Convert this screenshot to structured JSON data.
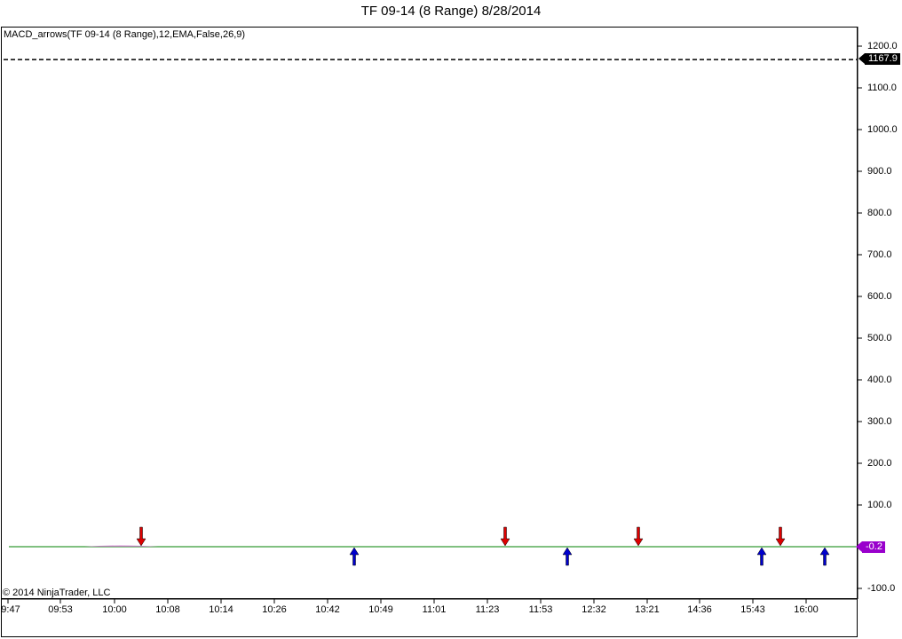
{
  "window": {
    "title": "TF 09-14 (8 Range)  8/28/2014"
  },
  "indicator": {
    "label": "MACD_arrows(TF 09-14 (8 Range),12,EMA,False,26,9)"
  },
  "copyright": "© 2014 NinjaTrader, LLC",
  "price_axis": {
    "ticks": [
      "1200.0",
      "1100.0",
      "1000.0",
      "900.0",
      "800.0",
      "700.0",
      "600.0",
      "500.0",
      "400.0",
      "300.0",
      "200.0",
      "100.0",
      "-100.0"
    ],
    "last_price": "1167.9",
    "macd_value": "-0.2"
  },
  "time_axis": {
    "ticks": [
      "9:47",
      "09:53",
      "10:00",
      "10:08",
      "10:14",
      "10:26",
      "10:42",
      "10:49",
      "11:01",
      "11:23",
      "11:53",
      "12:32",
      "13:21",
      "14:36",
      "15:43",
      "16:00"
    ]
  },
  "colors": {
    "zero_line": "#008000",
    "down_arrow": "#dd0000",
    "up_arrow": "#0000cc",
    "price_line": "#000000",
    "macd_tag": "#9900cc"
  },
  "chart_data": {
    "type": "line",
    "series": [
      {
        "values": [
          1167.9,
          1167.9
        ]
      },
      {
        "values": [
          0,
          0
        ]
      }
    ],
    "arrows": [
      {
        "time": "10:04",
        "direction": "down"
      },
      {
        "time": "10:45",
        "direction": "up"
      },
      {
        "time": "11:27",
        "direction": "down"
      },
      {
        "time": "12:00",
        "direction": "up"
      },
      {
        "time": "13:14",
        "direction": "down"
      },
      {
        "time": "15:40",
        "direction": "up"
      },
      {
        "time": "15:50",
        "direction": "down"
      },
      {
        "time": "16:04",
        "direction": "up"
      }
    ],
    "ylim": [
      -130,
      1240
    ],
    "grid": false,
    "xlabel": "",
    "ylabel": ""
  }
}
